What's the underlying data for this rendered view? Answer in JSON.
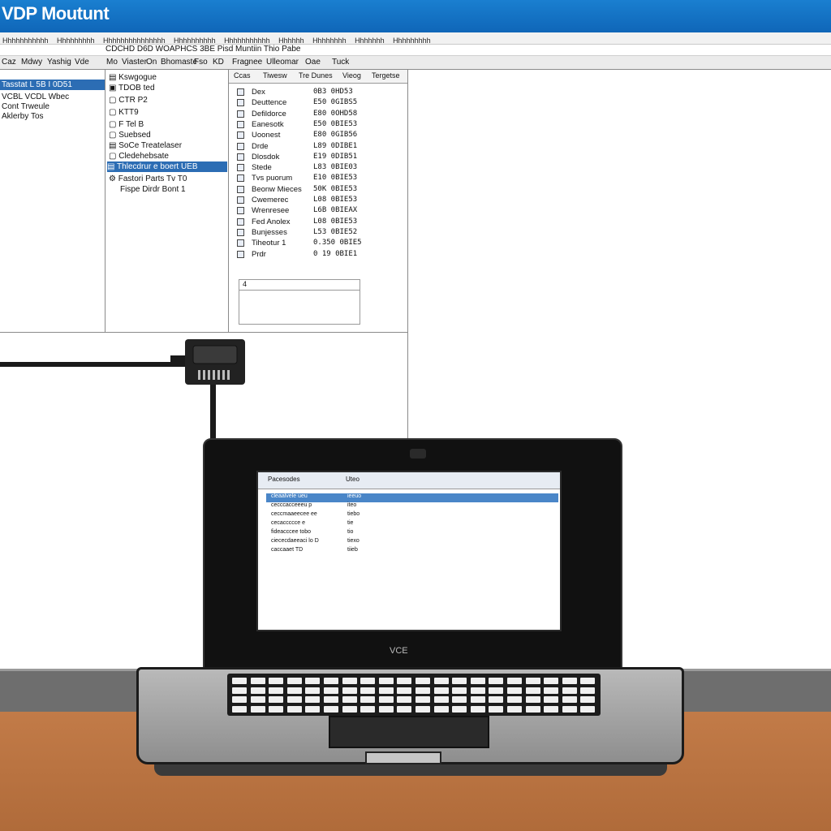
{
  "window": {
    "title": "VDP Moutunt"
  },
  "menubar": {
    "items": [
      "Hhhhhhhhhhh",
      "Hhhhhhhhh",
      "Hhhhhhhhhhhhhhh",
      "Hhhhhhhhhh",
      "Hhhhhhhhhhh",
      "Hhhhhh",
      "Hhhhhhhh",
      "Hhhhhhh",
      "Hhhhhhhhh"
    ]
  },
  "toolbar": {
    "items": [
      "Caz",
      "Mdwy",
      "Yashig",
      "Vde",
      "Mo",
      "Viaster",
      "On",
      "Bhomaste",
      "Fso",
      "KD",
      "Fragnee",
      "Ulleomar",
      "Oae",
      "Tuck"
    ],
    "tab_label": "CDCHD D6D WOAPHCS 3BE Pisd Muntiin Thio Pabe"
  },
  "left_panel": {
    "rows": [
      {
        "label": "Tasstat  L  5B  I 0D51",
        "selected": true
      },
      {
        "label": "VCBL    VCDL    Wbec"
      },
      {
        "label": "Cont    Trweule"
      },
      {
        "label": "Aklerby   Tos"
      }
    ]
  },
  "mid_panel": {
    "rows": [
      {
        "label": "Kswgogue"
      },
      {
        "label": "TDOB  ted"
      },
      {
        "label": "CTR  P2"
      },
      {
        "label": "KTT9"
      },
      {
        "label": "F  Tel B"
      },
      {
        "label": "Suebsed"
      },
      {
        "label": "SoCe  Treatelaser"
      },
      {
        "label": "Cledehebsate"
      },
      {
        "label": "Thlecdrur  e  boert  UEB",
        "selected": true
      },
      {
        "label": "Fastori  Parts   Tv   T0"
      },
      {
        "label": "Fispe   Dirdr  Bont   1"
      }
    ]
  },
  "right_panel": {
    "headers": [
      "Ccas",
      "Tiwesw",
      "Tre Dunes",
      "Vieog",
      "Tergetse"
    ],
    "rows": [
      {
        "name": "Dex",
        "value": "0B3 0HD53"
      },
      {
        "name": "Deuttence",
        "value": "E50 0GIBS5"
      },
      {
        "name": "Defildorce",
        "value": "E80 0OHD58"
      },
      {
        "name": "Eanesotk",
        "value": "E50 0BIE53"
      },
      {
        "name": "Uoonest",
        "value": "E80 0GIB56"
      },
      {
        "name": "Drde",
        "value": "L89 0DIBE1"
      },
      {
        "name": "Dlosdok",
        "value": "E19 0DIB51"
      },
      {
        "name": "Stede",
        "value": "L83 0BIE03"
      },
      {
        "name": "Tvs  puorum",
        "value": "E10 0BIE53"
      },
      {
        "name": "Beonw  Mieces",
        "value": "50K 0BIE53"
      },
      {
        "name": "Cwemerec",
        "value": "L08 0BIE53"
      },
      {
        "name": "Wrenresee",
        "value": "L6B 0BIEAX"
      },
      {
        "name": "Fed  Anolex",
        "value": "L08 0BIE53"
      },
      {
        "name": "Bunjesses",
        "value": "L53 0BIE52"
      },
      {
        "name": "Tiheotur  1",
        "value": "0.350 0BIE5"
      },
      {
        "name": "Prdr",
        "value": "0 19 0BIE1"
      }
    ],
    "info_field": "4"
  },
  "laptop": {
    "brand": "VCE",
    "inner_window": {
      "headers": [
        "Pacesodes",
        "Uteo"
      ],
      "rows": [
        {
          "left": "cleaalvele  ueu",
          "right": "ieeuo",
          "selected": true
        },
        {
          "left": "cecccacceeeu  p",
          "right": "iteo"
        },
        {
          "left": "ceccmaaeecee  ee",
          "right": "tiebo"
        },
        {
          "left": "cecaccccce  e",
          "right": "tie"
        },
        {
          "left": "fideacccee  tobo",
          "right": "tio"
        },
        {
          "left": "ciececdaeeaci  lo  D",
          "right": "tiexo"
        },
        {
          "left": "caccaaet  TD",
          "right": "tiieb"
        }
      ]
    }
  },
  "colors": {
    "title_bar": "#1472c7",
    "selection": "#2c6db4",
    "desk": "#b9713f"
  },
  "icons": [
    "usb-connector-icon",
    "folder-icon",
    "file-icon"
  ]
}
